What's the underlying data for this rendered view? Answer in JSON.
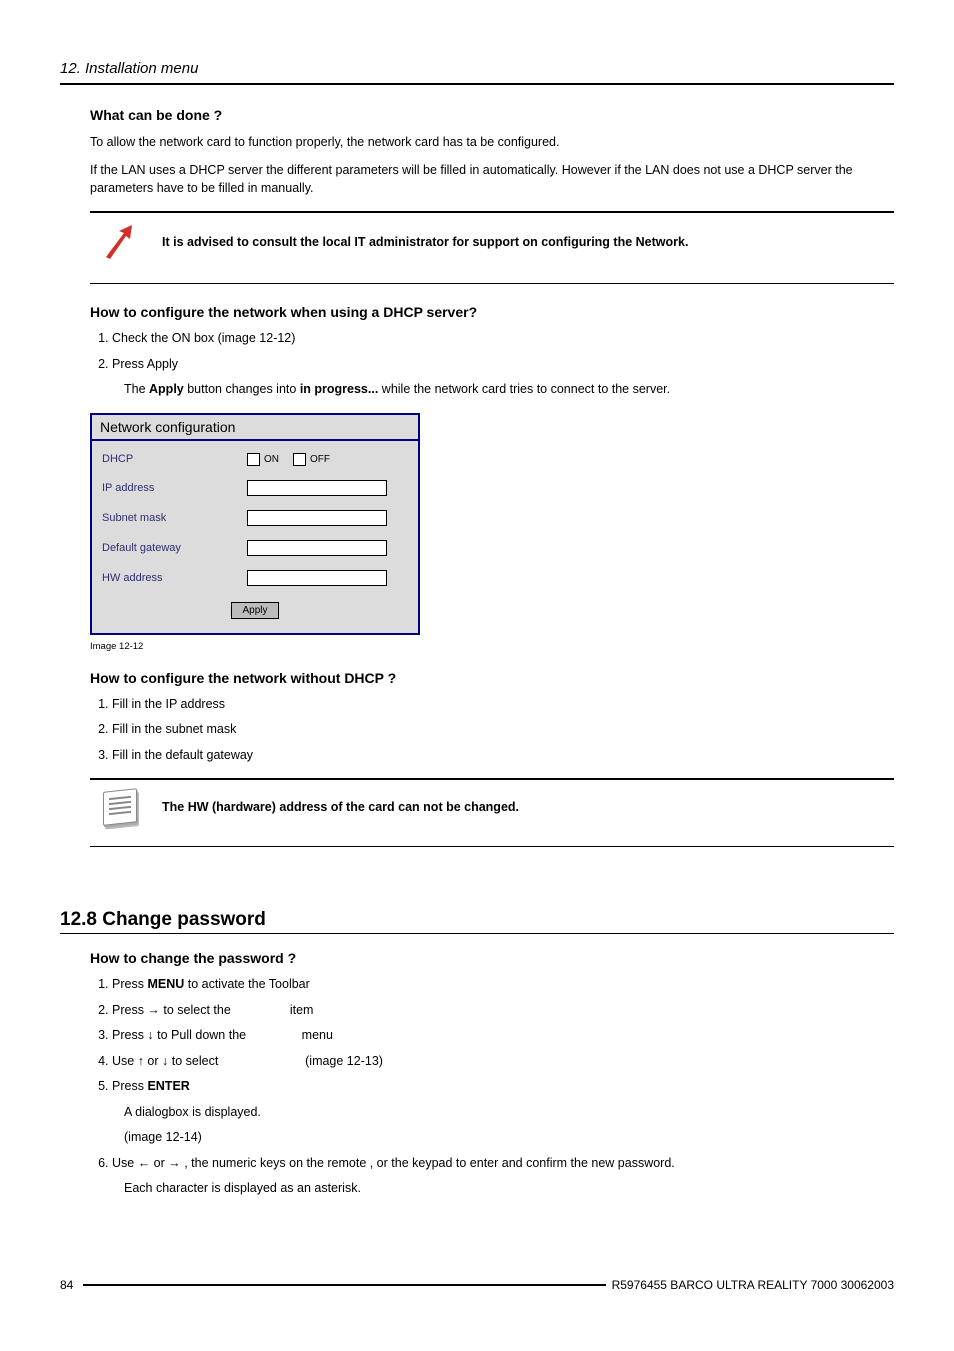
{
  "running_head": "12.  Installation menu",
  "sec_what_title": "What can be done ?",
  "sec_what_p1": "To allow the network card to function properly, the network card has ta be configured.",
  "sec_what_p2": "If the LAN uses a DHCP server the different parameters will be filled in automatically.  However if the LAN does not use a DHCP server the parameters have to be filled in manually.",
  "note1_text": "It is advised to consult the local IT administrator for support on configuring the Network.",
  "sec_cfg_dhcp_title": "How to configure the network when using a DHCP server?",
  "steps_dhcp": [
    "Check the ON box (image 12-12)",
    "Press Apply"
  ],
  "dhcp_sub_pre": "The ",
  "dhcp_sub_apply": "Apply",
  "dhcp_sub_mid": " button changes into ",
  "dhcp_sub_prog": "in progress...",
  "dhcp_sub_post": "  while the network card tries to connect to the server.",
  "dialog": {
    "title": "Network configuration",
    "dhcp": "DHCP",
    "on": "ON",
    "off": "OFF",
    "ip": "IP address",
    "subnet": "Subnet mask",
    "gateway": "Default gateway",
    "hw": "HW address",
    "apply": "Apply"
  },
  "image_caption": "Image 12-12",
  "sec_cfg_nodhcp_title": "How to configure the network without DHCP ?",
  "steps_nodhcp": [
    "Fill in the IP address",
    "Fill in the subnet mask",
    "Fill in the default gateway"
  ],
  "note2_text": "The HW (hardware) address of the card can not be changed.",
  "section_heading": "12.8 Change password",
  "sec_pw_title": "How to change the password ?",
  "pw": {
    "s1a": "Press ",
    "s1b": "MENU",
    "s1c": " to activate the Toolbar",
    "s2a": "Press → to select the ",
    "s2b_gap": "               ",
    "s2c": " item",
    "s3a": "Press ↓ to Pull down the ",
    "s3b_gap": "              ",
    "s3c": " menu",
    "s4a": "Use ↑ or ↓ to select ",
    "s4b_gap": "                       ",
    "s4c": " (image 12-13)",
    "s5a": "Press ",
    "s5b": "ENTER",
    "s5_sub1": "A dialogbox is displayed.",
    "s5_sub2": "(image 12-14)",
    "s6": "Use ← or → , the numeric keys on the remote , or the keypad to enter and confirm the new password.",
    "s6_sub": "Each character is displayed as an asterisk."
  },
  "page_number": "84",
  "footer_label": "R5976455   BARCO ULTRA REALITY 7000  30062003"
}
